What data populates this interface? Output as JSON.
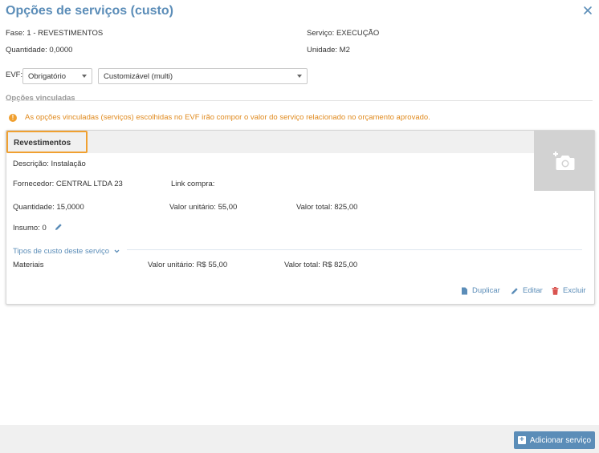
{
  "dialog": {
    "title": "Opções de serviços (custo)"
  },
  "info": {
    "fase_label": "Fase:",
    "fase_value": "1 - REVESTIMENTOS",
    "servico_label": "Serviço:",
    "servico_value": "EXECUÇÃO",
    "quantidade_label": "Quantidade:",
    "quantidade_value": "0,0000",
    "unidade_label": "Unidade:",
    "unidade_value": "M2"
  },
  "evf": {
    "label": "EVF:",
    "select1_value": "Obrigatório",
    "select2_value": "Customizável (multi)"
  },
  "section": {
    "label": "Opções vinculadas"
  },
  "alert": {
    "icon": "!",
    "text": "As opções vinculadas (serviços) escolhidas no EVF irão compor o valor do serviço relacionado no orçamento aprovado."
  },
  "card": {
    "title": "Revestimentos",
    "descricao_label": "Descrição:",
    "descricao_value": "Instalação",
    "fornecedor_label": "Fornecedor:",
    "fornecedor_value": "CENTRAL LTDA 23",
    "link_label": "Link compra:",
    "quantidade_label": "Quantidade:",
    "quantidade_value": "15,0000",
    "valor_unitario_label": "Valor unitário:",
    "valor_unitario_value": "55,00",
    "valor_total_label": "Valor total:",
    "valor_total_value": "825,00",
    "insumo_label": "Insumo:",
    "insumo_value": "0",
    "types_link": "Tipos de custo deste serviço",
    "cost_row": {
      "name": "Materiais",
      "valor_unitario_label": "Valor unitário:",
      "valor_unitario_value": "R$ 55,00",
      "valor_total_label": "Valor total:",
      "valor_total_value": "R$ 825,00"
    },
    "actions": {
      "duplicar": "Duplicar",
      "editar": "Editar",
      "excluir": "Excluir"
    }
  },
  "footer": {
    "add_button": "Adicionar serviço"
  },
  "colors": {
    "accent": "#5b8db8",
    "warning": "#e08a1e",
    "highlight": "#f0a030",
    "danger": "#d9534f"
  }
}
